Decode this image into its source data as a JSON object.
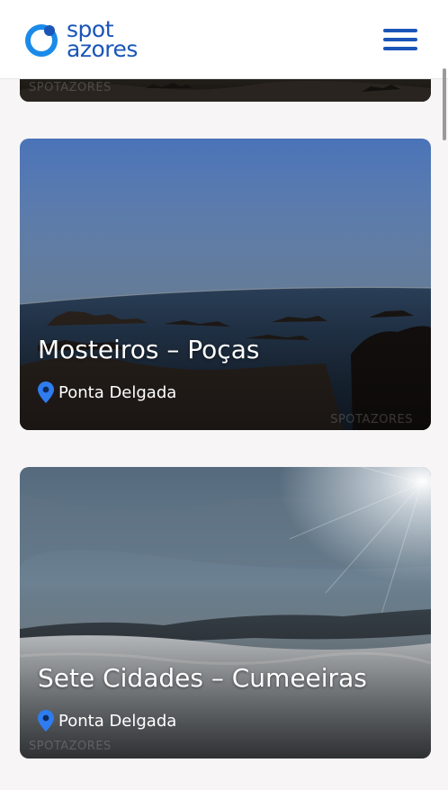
{
  "header": {
    "logo_line1": "spot",
    "logo_line2": "azores",
    "menu_icon": "hamburger-menu-icon",
    "brand_color": "#1a55b8"
  },
  "cards": [
    {
      "title": "Mosteiros – Poças",
      "location": "Ponta Delgada",
      "watermark": "SPOTAZORES"
    },
    {
      "title": "Sete Cidades – Cumeeiras",
      "location": "Ponta Delgada",
      "watermark": "SPOTAZORES"
    }
  ],
  "top_card": {
    "watermark": "SPOTAZORES"
  },
  "pin_color": "#2f7cf0"
}
